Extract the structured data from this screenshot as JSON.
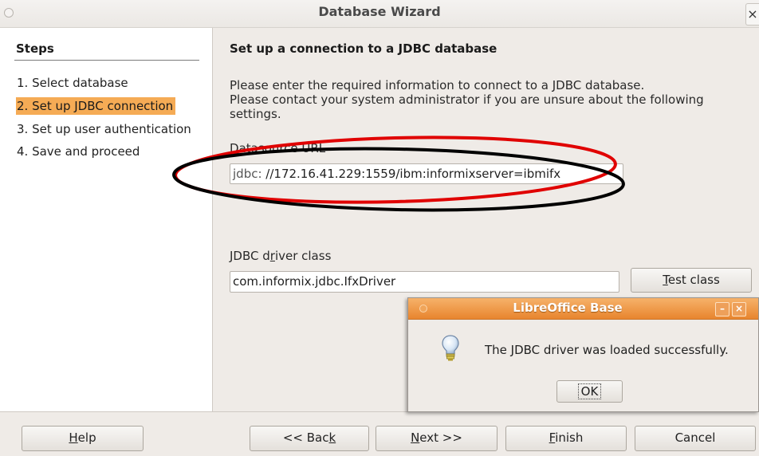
{
  "window": {
    "title": "Database Wizard",
    "close_glyph": "×"
  },
  "sidebar": {
    "heading": "Steps",
    "items": [
      {
        "label": "1. Select database",
        "active": false
      },
      {
        "label": "2. Set up JDBC connection",
        "active": true
      },
      {
        "label": "3. Set up user authentication",
        "active": false
      },
      {
        "label": "4. Save and proceed",
        "active": false
      }
    ]
  },
  "main": {
    "heading": "Set up a connection to a JDBC database",
    "description_lines": [
      "Please enter the required information to connect to a JDBC database.",
      "Please contact your system administrator if you are unsure about the following",
      "settings."
    ],
    "datasource": {
      "label_mnemonic": "D",
      "label_rest": "atasource URL",
      "prefix": "jdbc:",
      "value": "//172.16.41.229:1559/ibm:informixserver=ibmifx"
    },
    "driver": {
      "label_before": "JDBC d",
      "label_mnemonic": "r",
      "label_after": "iver class",
      "value": "com.informix.jdbc.IfxDriver",
      "test_mnemonic": "T",
      "test_rest": "est class"
    }
  },
  "footer": {
    "help_mnemonic": "H",
    "help_rest": "elp",
    "back_before": "<< Bac",
    "back_mnemonic": "k",
    "next_mnemonic": "N",
    "next_rest": "ext >>",
    "finish_mnemonic": "F",
    "finish_rest": "inish",
    "cancel_label": "Cancel"
  },
  "dialog": {
    "title": "LibreOffice Base",
    "message": "The JDBC driver was loaded successfully.",
    "ok_label": "OK",
    "minimize_glyph": "–",
    "close_glyph": "×",
    "icon": "lightbulb-info-icon",
    "accent": "#e8852e"
  },
  "annotation": {
    "red_color": "#e00000",
    "black_color": "#000000"
  }
}
